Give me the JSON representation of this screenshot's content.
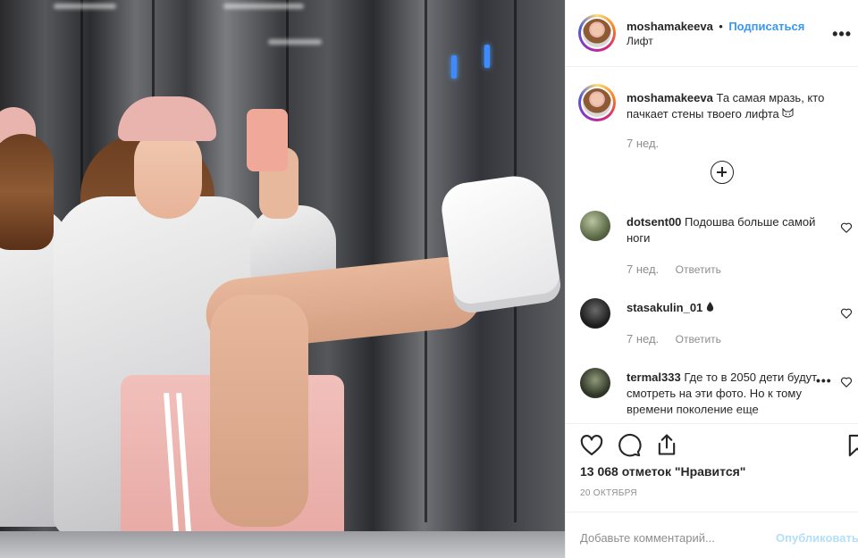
{
  "post": {
    "username": "moshamakeeva",
    "separator": "•",
    "follow_label": "Подписаться",
    "location": "Лифт",
    "more_icon": "more-horizontal-icon"
  },
  "caption": {
    "username": "moshamakeeva",
    "text": "Та самая мразь, кто пачкает стены твоего лифта",
    "emoji_icon": "cat-face-icon",
    "time": "7 нед."
  },
  "load_more_icon": "plus-circle-icon",
  "comments": [
    {
      "username": "dotsent00",
      "text": "Подошва больше самой ноги",
      "time": "7 нед.",
      "reply": "Ответить"
    },
    {
      "username": "stasakulin_01",
      "text": "",
      "emoji_icon": "drop-icon",
      "time": "7 нед.",
      "reply": "Ответить"
    },
    {
      "username": "termal333",
      "text": "Где то в 2050 дети будут смотреть на эти фото. Но к тому времени поколение еще"
    }
  ],
  "actions": {
    "like_icon": "heart-icon",
    "comment_icon": "comment-icon",
    "share_icon": "share-icon",
    "save_icon": "bookmark-icon"
  },
  "likes": "13 068 отметок \"Нравится\"",
  "date": "20 ОКТЯБРЯ",
  "add_comment": {
    "placeholder": "Добавьте комментарий...",
    "post_label": "Опубликовать"
  },
  "colors": {
    "link": "#3897f0",
    "muted": "#8e8e8e",
    "text": "#262626",
    "post_disabled": "#b2dffc"
  }
}
